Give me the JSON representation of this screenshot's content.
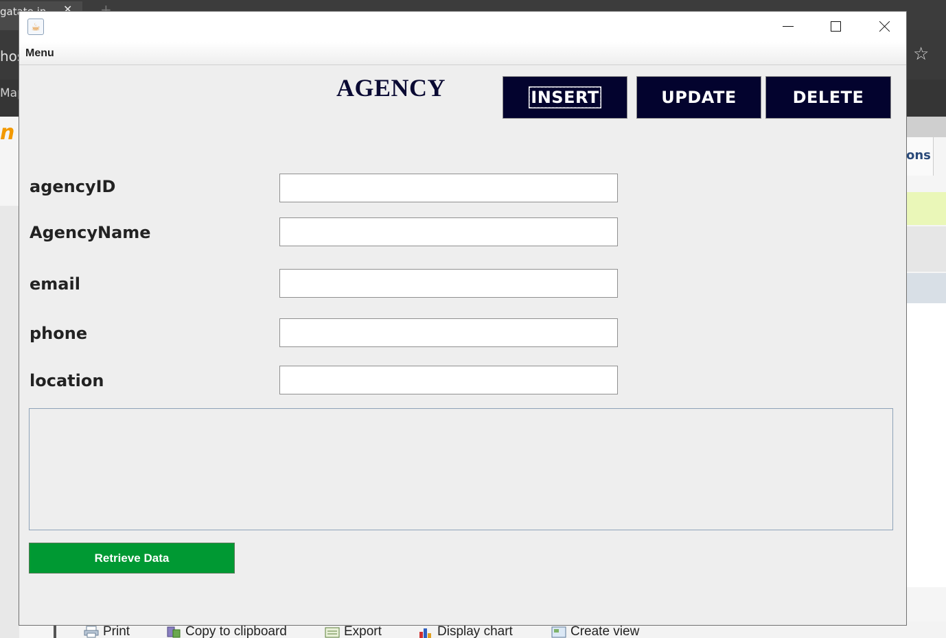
{
  "background_browser": {
    "tab_title": "gatate.in",
    "tab_close": "✕",
    "new_tab": "+",
    "omnibox_fragment": "hos",
    "bookmark_fragment": "Map",
    "logo_fragment": "n",
    "right_tab_fragment": "ons",
    "bottom_toolbar": [
      {
        "label": "Print",
        "icon": "printer-icon"
      },
      {
        "label": "Copy to clipboard",
        "icon": "clipboard-icon"
      },
      {
        "label": "Export",
        "icon": "export-icon"
      },
      {
        "label": "Display chart",
        "icon": "chart-icon"
      },
      {
        "label": "Create view",
        "icon": "view-icon"
      }
    ]
  },
  "window": {
    "app_icon": "java-icon",
    "menu": {
      "label": "Menu"
    },
    "title": "AGENCY",
    "actions": {
      "insert": "INSERT",
      "update": "UPDATE",
      "delete": "DELETE"
    },
    "form": {
      "agency_id": {
        "label": "agencyID",
        "value": ""
      },
      "agency_name": {
        "label": "AgencyName",
        "value": ""
      },
      "email": {
        "label": "email",
        "value": ""
      },
      "phone": {
        "label": "phone",
        "value": ""
      },
      "location": {
        "label": "location",
        "value": ""
      }
    },
    "output_area": {
      "value": ""
    },
    "retrieve_button": "Retrieve Data",
    "colors": {
      "action_button_bg": "#03032e",
      "retrieve_button_bg": "#009933",
      "window_bg": "#eeeeee"
    }
  }
}
